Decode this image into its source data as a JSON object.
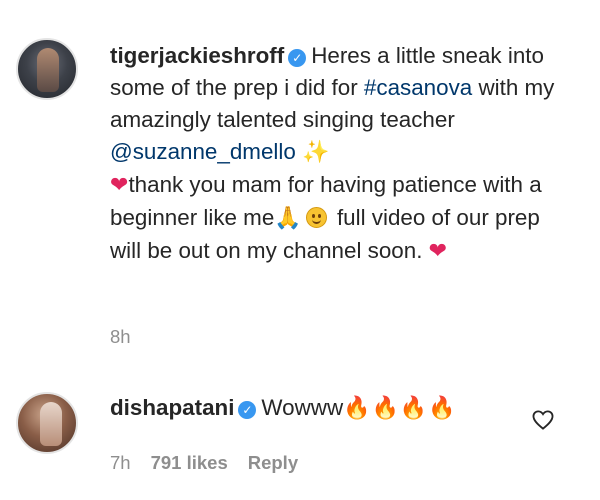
{
  "comments": [
    {
      "username": "tigerjackieshroff",
      "text_1": "Heres a little sneak into some of the prep i did for",
      "hashtag": "#casanova",
      "text_2": "with my amazingly talented singing teacher",
      "mention": "@suzanne_dmello",
      "text_3": "thank you mam for having patience with a beginner like me",
      "text_4": "full video of our prep will be out on my channel soon.",
      "time": "8h"
    },
    {
      "username": "dishapatani",
      "text": "Wowww",
      "fire_emojis": "🔥🔥🔥🔥",
      "time": "7h",
      "likes": "791 likes",
      "reply_label": "Reply"
    }
  ],
  "icons": {
    "verified": "verified-badge-icon",
    "heart": "heart-icon",
    "colors": {
      "verified": "#3897f0",
      "link": "#00376b",
      "meta": "#8e8e8e"
    }
  }
}
